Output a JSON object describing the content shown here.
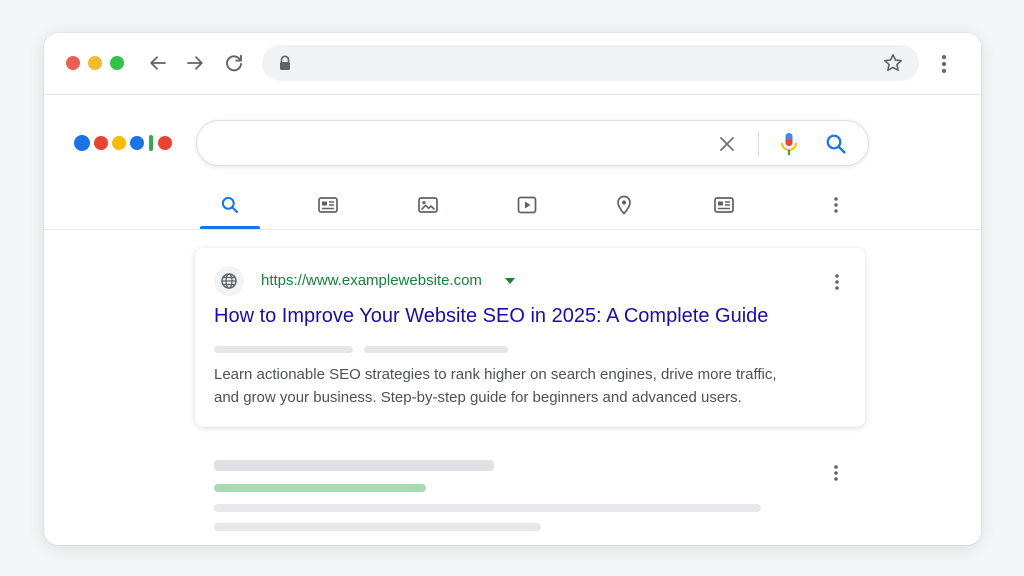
{
  "browser": {
    "address": {
      "value": "",
      "placeholder": ""
    },
    "icons": [
      "back-arrow-icon",
      "forward-arrow-icon",
      "reload-icon",
      "lock-icon",
      "star-icon",
      "more-vert-icon"
    ]
  },
  "search": {
    "query": "",
    "placeholder": "",
    "icons": [
      "clear-icon",
      "microphone-icon",
      "search-icon"
    ]
  },
  "tabs": [
    {
      "icon": "search-icon",
      "active": true
    },
    {
      "icon": "news-icon",
      "active": false
    },
    {
      "icon": "image-icon",
      "active": false
    },
    {
      "icon": "video-icon",
      "active": false
    },
    {
      "icon": "map-pin-icon",
      "active": false
    },
    {
      "icon": "shopping-card-icon",
      "active": false
    },
    {
      "icon": "more-vert-icon",
      "active": false
    }
  ],
  "result": {
    "url": "https://www.examplewebsite.com",
    "title": "How to Improve Your Website SEO in 2025: A Complete Guide",
    "snippet_line1": "Learn actionable SEO strategies to rank higher on search engines, drive more traffic,",
    "snippet_line2": "and grow your business. Step-by-step guide for beginners and advanced users."
  },
  "colors": {
    "accent": "#1a73e8",
    "link": "#1a0dab",
    "url": "#188038",
    "snippet": "#4d5156",
    "logo_dots": [
      "#1a73e8",
      "#ea4335",
      "#fbbc05",
      "#1a73e8",
      "#34a853",
      "#ea4335"
    ]
  }
}
